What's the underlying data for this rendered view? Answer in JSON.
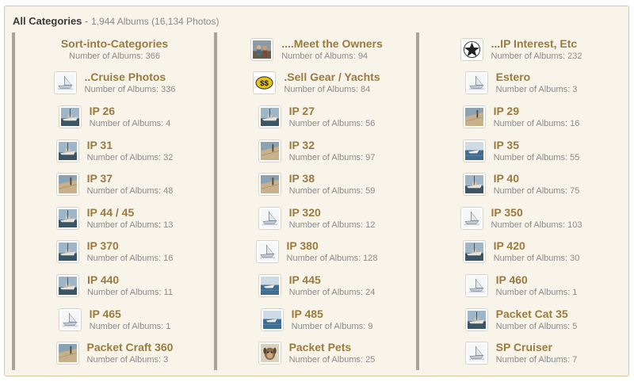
{
  "header": {
    "title": "All Categories",
    "separator": "-",
    "summary": "1,944 Albums (16,134 Photos)"
  },
  "count_prefix": "Number of Albums:",
  "categories": [
    {
      "name": "Sort-into-Categories",
      "albums": 366,
      "thumb": "none"
    },
    {
      "name": "....Meet the Owners",
      "albums": 94,
      "thumb": "people-photo"
    },
    {
      "name": "...IP Interest, Etc",
      "albums": 232,
      "thumb": "star-icon"
    },
    {
      "name": "..Cruise Photos",
      "albums": 336,
      "thumb": "boat-drawing"
    },
    {
      "name": ".Sell Gear / Yachts",
      "albums": 84,
      "thumb": "dollar-icon"
    },
    {
      "name": "Estero",
      "albums": 3,
      "thumb": "boat-drawing"
    },
    {
      "name": "IP 26",
      "albums": 4,
      "thumb": "boat-photo"
    },
    {
      "name": "IP 27",
      "albums": 56,
      "thumb": "boat-photo"
    },
    {
      "name": "IP 29",
      "albums": 16,
      "thumb": "deck-photo"
    },
    {
      "name": "IP 31",
      "albums": 32,
      "thumb": "boat-photo"
    },
    {
      "name": "IP 32",
      "albums": 97,
      "thumb": "deck-photo"
    },
    {
      "name": "IP 35",
      "albums": 55,
      "thumb": "water-photo"
    },
    {
      "name": "IP 37",
      "albums": 48,
      "thumb": "deck-photo"
    },
    {
      "name": "IP 38",
      "albums": 59,
      "thumb": "deck-photo"
    },
    {
      "name": "IP 40",
      "albums": 75,
      "thumb": "boat-photo"
    },
    {
      "name": "IP 44 / 45",
      "albums": 13,
      "thumb": "boat-photo"
    },
    {
      "name": "IP 320",
      "albums": 12,
      "thumb": "boat-drawing"
    },
    {
      "name": "IP 350",
      "albums": 103,
      "thumb": "boat-drawing"
    },
    {
      "name": "IP 370",
      "albums": 16,
      "thumb": "boat-photo"
    },
    {
      "name": "IP 380",
      "albums": 128,
      "thumb": "boat-drawing"
    },
    {
      "name": "IP 420",
      "albums": 30,
      "thumb": "boat-photo"
    },
    {
      "name": "IP 440",
      "albums": 11,
      "thumb": "boat-photo"
    },
    {
      "name": "IP 445",
      "albums": 24,
      "thumb": "water-photo"
    },
    {
      "name": "IP 460",
      "albums": 1,
      "thumb": "boat-drawing"
    },
    {
      "name": "IP 465",
      "albums": 1,
      "thumb": "boat-drawing"
    },
    {
      "name": "IP 485",
      "albums": 9,
      "thumb": "water-photo"
    },
    {
      "name": "Packet Cat 35",
      "albums": 5,
      "thumb": "boat-photo"
    },
    {
      "name": "Packet Craft 360",
      "albums": 3,
      "thumb": "deck-photo"
    },
    {
      "name": "Packet Pets",
      "albums": 25,
      "thumb": "pet-photo"
    },
    {
      "name": "SP Cruiser",
      "albums": 7,
      "thumb": "boat-drawing"
    }
  ],
  "colors": {
    "panel_bg": "#f8f4ea",
    "panel_border": "#d8c8a0",
    "category_link": "#9b7a3e",
    "column_rule": "#a8a29a",
    "muted_text": "#8a8a8a"
  }
}
